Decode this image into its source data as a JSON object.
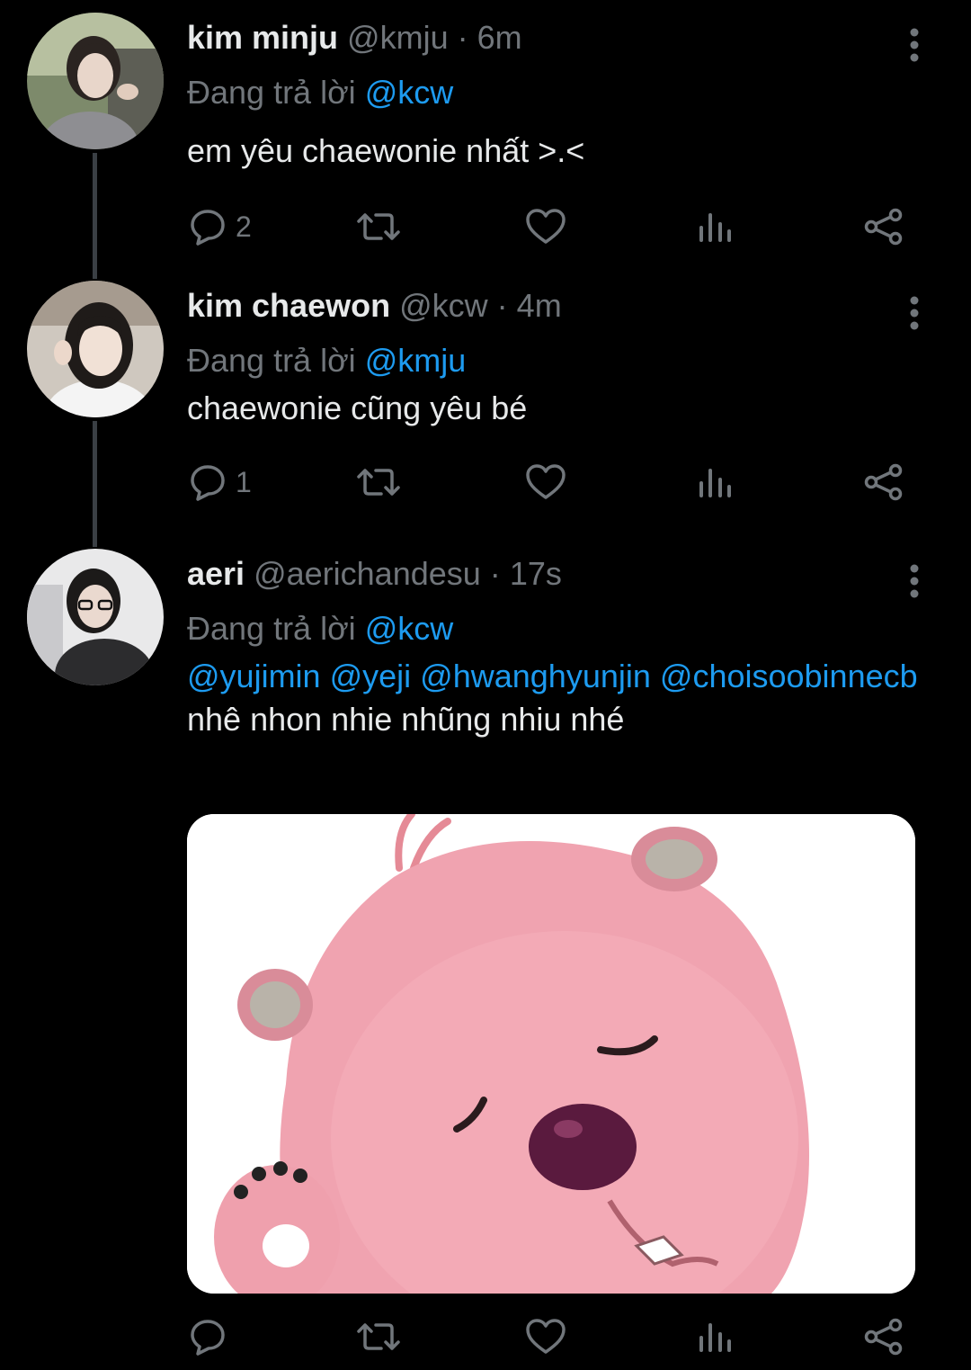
{
  "colors": {
    "background": "#000000",
    "text": "#e7e9ea",
    "muted": "#71767b",
    "link": "#1d9bf0",
    "thread_line": "#3a3f44"
  },
  "tweets": [
    {
      "name": "kim minju",
      "handle": "@kmju",
      "dot": "·",
      "time": "6m",
      "replying_prefix": "Đang trả lời",
      "replying_to": "@kcw",
      "text": "em yêu chaewonie nhất >.<",
      "reply_count": "2",
      "icons": [
        "reply-icon",
        "retweet-icon",
        "like-icon",
        "views-icon",
        "share-icon",
        "more-icon"
      ]
    },
    {
      "name": "kim chaewon",
      "handle": "@kcw",
      "dot": "·",
      "time": "4m",
      "replying_prefix": "Đang trả lời",
      "replying_to": "@kmju",
      "text": "chaewonie cũng yêu bé",
      "reply_count": "1",
      "icons": [
        "reply-icon",
        "retweet-icon",
        "like-icon",
        "views-icon",
        "share-icon",
        "more-icon"
      ]
    },
    {
      "name": "aeri",
      "handle": "@aerichandesu",
      "dot": "·",
      "time": "17s",
      "replying_prefix": "Đang trả lời",
      "replying_to": "@kcw",
      "mentions": [
        "@yujimin",
        "@yeji",
        "@hwanghyunjin",
        "@choisoobinnecb"
      ],
      "text_tail": "nhê nhon nhie nhũng nhiu nhé",
      "media": "pink-beaver-cartoon-image",
      "icons": [
        "reply-icon",
        "retweet-icon",
        "like-icon",
        "views-icon",
        "share-icon",
        "more-icon"
      ]
    }
  ]
}
